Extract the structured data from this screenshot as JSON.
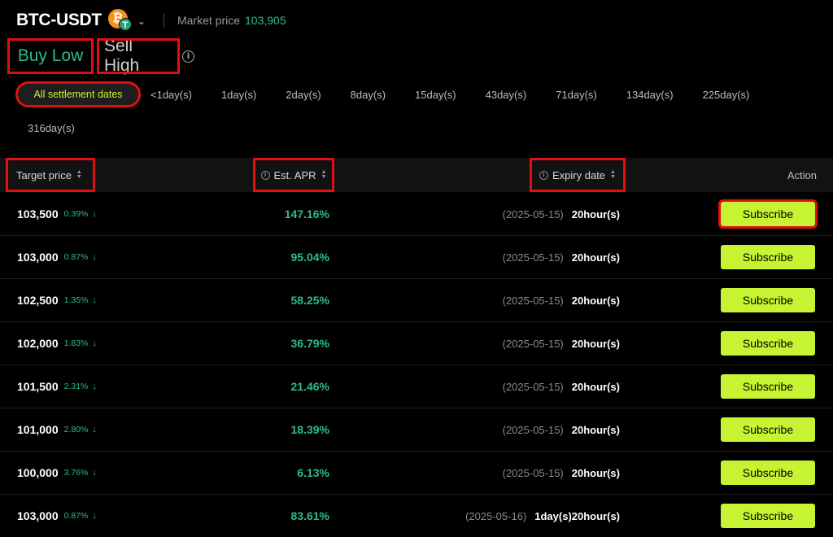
{
  "header": {
    "pair": "BTC-USDT",
    "coin_icons": {
      "base": "bitcoin-icon",
      "quote": "tether-icon",
      "base_glyph": "₿",
      "quote_glyph": "T"
    },
    "market_price_label": "Market price",
    "market_price_value": "103,905"
  },
  "modes": {
    "buy_low": "Buy Low",
    "sell_high": "Sell High",
    "active": "Buy Low"
  },
  "settlement_dates": {
    "active": "All settlement dates",
    "options": [
      "All settlement dates",
      "<1day(s)",
      "1day(s)",
      "2day(s)",
      "8day(s)",
      "15day(s)",
      "43day(s)",
      "71day(s)",
      "134day(s)",
      "225day(s)",
      "316day(s)"
    ]
  },
  "table": {
    "headers": {
      "target_price": "Target price",
      "est_apr": "Est. APR",
      "expiry_date": "Expiry date",
      "action": "Action"
    },
    "rows": [
      {
        "price": "103,500",
        "pct": "0.39%",
        "apr": "147.16%",
        "expiry": "(2025-05-15)",
        "hours": "20hour(s)",
        "action": "Subscribe"
      },
      {
        "price": "103,000",
        "pct": "0.87%",
        "apr": "95.04%",
        "expiry": "(2025-05-15)",
        "hours": "20hour(s)",
        "action": "Subscribe"
      },
      {
        "price": "102,500",
        "pct": "1.35%",
        "apr": "58.25%",
        "expiry": "(2025-05-15)",
        "hours": "20hour(s)",
        "action": "Subscribe"
      },
      {
        "price": "102,000",
        "pct": "1.83%",
        "apr": "36.79%",
        "expiry": "(2025-05-15)",
        "hours": "20hour(s)",
        "action": "Subscribe"
      },
      {
        "price": "101,500",
        "pct": "2.31%",
        "apr": "21.46%",
        "expiry": "(2025-05-15)",
        "hours": "20hour(s)",
        "action": "Subscribe"
      },
      {
        "price": "101,000",
        "pct": "2.80%",
        "apr": "18.39%",
        "expiry": "(2025-05-15)",
        "hours": "20hour(s)",
        "action": "Subscribe"
      },
      {
        "price": "100,000",
        "pct": "3.76%",
        "apr": "6.13%",
        "expiry": "(2025-05-15)",
        "hours": "20hour(s)",
        "action": "Subscribe"
      },
      {
        "price": "103,000",
        "pct": "0.87%",
        "apr": "83.61%",
        "expiry": "(2025-05-16)",
        "hours": "1day(s)20hour(s)",
        "action": "Subscribe"
      }
    ]
  },
  "colors": {
    "accent_green": "#2ebd85",
    "button_lime": "#c6f432",
    "highlight_red": "#e01010",
    "background": "#000000"
  }
}
